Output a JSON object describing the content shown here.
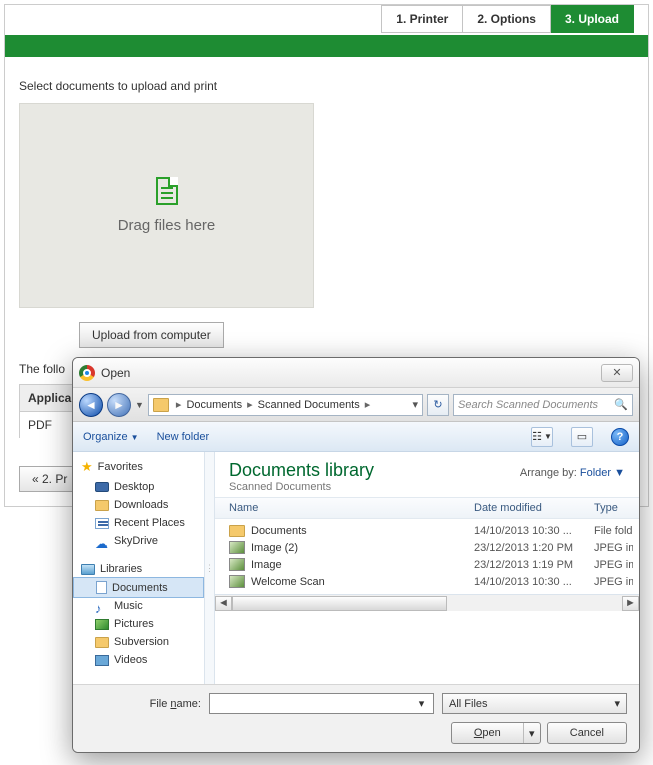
{
  "page": {
    "tabs": [
      "1. Printer",
      "2. Options",
      "3. Upload"
    ],
    "active_tab": 2,
    "prompt": "Select documents to upload and print",
    "dropzone": "Drag files here",
    "upload_btn": "Upload from computer",
    "following_partial": "The follo",
    "app_col": "Applica",
    "pdf_label": "PDF",
    "back_btn": "« 2. Pr"
  },
  "dialog": {
    "title": "Open",
    "crumbs": [
      "Documents",
      "Scanned Documents"
    ],
    "refresh": "↻",
    "search_placeholder": "Search Scanned Documents",
    "toolbar": {
      "organize": "Organize",
      "newfolder": "New folder"
    },
    "lib_title": "Documents library",
    "lib_sub": "Scanned Documents",
    "arrange_label": "Arrange by:",
    "arrange_value": "Folder",
    "columns": {
      "name": "Name",
      "date": "Date modified",
      "type": "Type"
    },
    "rows": [
      {
        "name": "Documents",
        "date": "14/10/2013 10:30 ...",
        "type": "File folder",
        "icon": "folder"
      },
      {
        "name": "Image (2)",
        "date": "23/12/2013 1:20 PM",
        "type": "JPEG imag",
        "icon": "image"
      },
      {
        "name": "Image",
        "date": "23/12/2013 1:19 PM",
        "type": "JPEG imag",
        "icon": "image"
      },
      {
        "name": "Welcome Scan",
        "date": "14/10/2013 10:30 ...",
        "type": "JPEG imag",
        "icon": "image"
      }
    ],
    "nav": {
      "favorites": "Favorites",
      "fav_items": [
        "Desktop",
        "Downloads",
        "Recent Places",
        "SkyDrive"
      ],
      "libraries": "Libraries",
      "lib_items": [
        "Documents",
        "Music",
        "Pictures",
        "Subversion",
        "Videos"
      ]
    },
    "file_label": "File name:",
    "filter": "All Files",
    "open": "Open",
    "cancel": "Cancel"
  }
}
